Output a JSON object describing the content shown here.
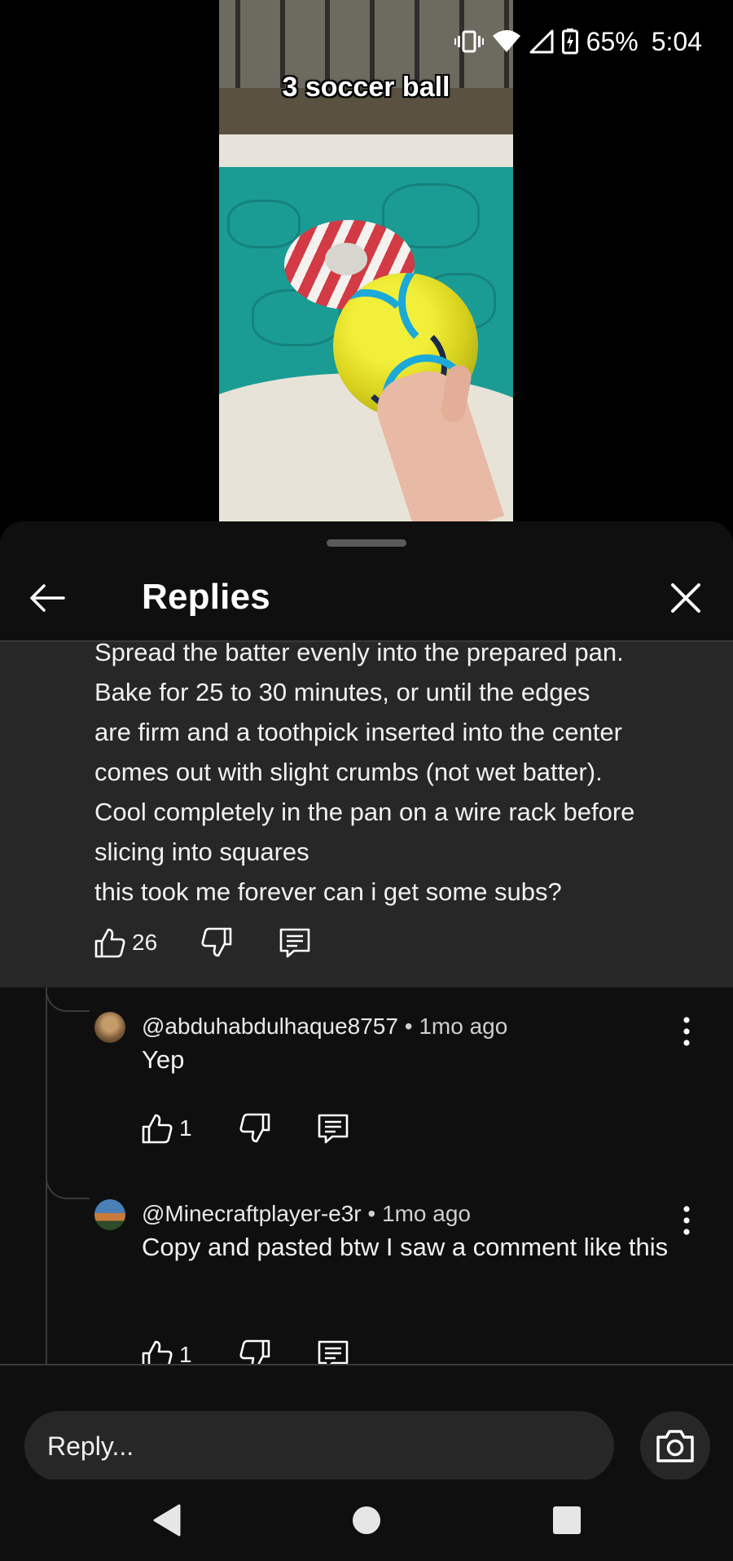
{
  "status_bar": {
    "icons": [
      "vibrate-icon",
      "wifi-icon",
      "signal-icon",
      "battery-charging-icon"
    ],
    "battery": "65%",
    "time": "5:04"
  },
  "video": {
    "caption": "3 soccer ball"
  },
  "sheet": {
    "title": "Replies",
    "back_icon": "arrow-left-icon",
    "close_icon": "close-icon"
  },
  "parent_comment": {
    "lines": [
      "Spread the batter evenly into the prepared pan.",
      "Bake for 25 to 30 minutes, or until the edges",
      "are firm and a toothpick inserted into the center",
      "comes out with slight crumbs (not wet batter).",
      "Cool completely in the pan on a wire rack before",
      "slicing into squares",
      "this took me forever can i get some subs?"
    ],
    "likes": "26"
  },
  "replies": [
    {
      "handle": "@abduhabdulhaque8757",
      "separator": " • ",
      "time": "1mo ago",
      "body": "Yep",
      "likes": "1"
    },
    {
      "handle": "@Minecraftplayer-e3r",
      "separator": " • ",
      "time": "1mo ago",
      "body": "Copy and pasted btw I saw a comment like this",
      "likes": "1"
    }
  ],
  "reply_bar": {
    "placeholder": "Reply...",
    "camera_icon": "camera-icon"
  },
  "nav_bar": {
    "icons": [
      "back-triangle-icon",
      "home-circle-icon",
      "recents-square-icon"
    ]
  },
  "colors": {
    "sheet_bg": "#0f0f0f",
    "highlight_bg": "#272727",
    "divider": "#3a3a3a",
    "text": "#f1f1f1"
  }
}
